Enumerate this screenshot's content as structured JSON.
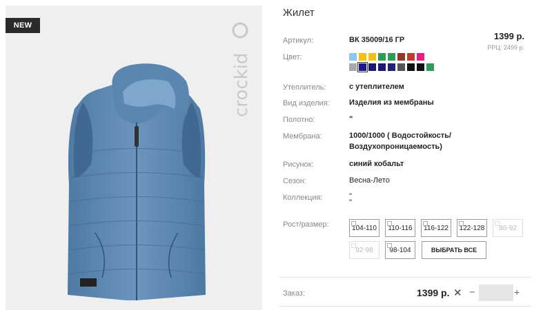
{
  "product": {
    "badge": "NEW",
    "brand": "crockid",
    "title": "Жилет",
    "price": "1399 р.",
    "rrp": "РРЦ: 2499 р."
  },
  "specs": [
    {
      "label": "Артикул:",
      "value": "ВК 35009/16 ГР"
    },
    {
      "label": "Цвет:",
      "value": ""
    },
    {
      "label": "Утеплитель:",
      "value": "с утеплителем"
    },
    {
      "label": "Вид изделия:",
      "value": "Изделия из мембраны"
    },
    {
      "label": "Полотно:",
      "value": "\""
    },
    {
      "label": "Мембрана:",
      "value": "1000/1000 ( Водостойкость/"
    },
    {
      "label": "Рисунок:",
      "value": "синий кобальт"
    },
    {
      "label": "Сезон:",
      "value": "Весна-Лето"
    },
    {
      "label": "Коллекция:",
      "value": "\""
    },
    {
      "label": "Рост/размер:",
      "value": ""
    }
  ],
  "membrane_line2": "Воздухопроницаемость)",
  "collection_line2": "\"",
  "colors": {
    "row1": [
      "#8ec7ea",
      "#f4c010",
      "#f4c010",
      "#2e9a5c",
      "#2e9a5c",
      "#8b3a2a",
      "#c0392b",
      "#e91e7f"
    ],
    "row2": [
      "#a9a9a9",
      "#1a1a8a",
      "#1a1a6e",
      "#1a1a6e",
      "#22226e",
      "#555555",
      "#111111",
      "#111111",
      "#2e9a5c"
    ],
    "selected_index_row2": 1
  },
  "sizes": [
    {
      "label": "104-110",
      "available": true
    },
    {
      "label": "110-116",
      "available": true
    },
    {
      "label": "116-122",
      "available": true
    },
    {
      "label": "122-128",
      "available": true
    },
    {
      "label": "86-92",
      "available": false
    },
    {
      "label": "92-98",
      "available": false
    },
    {
      "label": "98-104",
      "available": true
    }
  ],
  "select_all_label": "ВЫБРАТЬ ВСЕ",
  "order": {
    "label": "Заказ:",
    "price": "1399 р.",
    "remove_symbol": "✕",
    "minus_symbol": "−",
    "plus_symbol": "+",
    "quantity": ""
  }
}
